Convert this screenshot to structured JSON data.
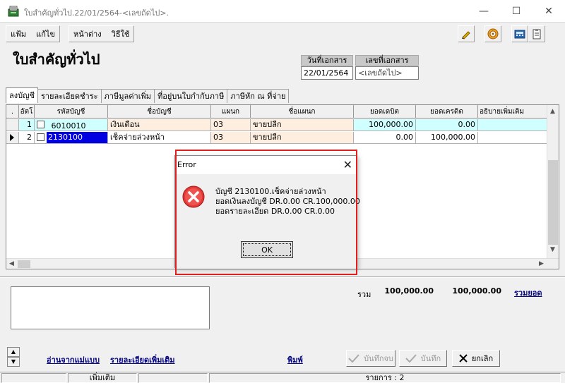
{
  "window": {
    "title": "ใบสำคัญทั่วไป.22/01/2564-<เลขถัดไป>.",
    "minimize": "—",
    "maximize": "☐",
    "close": "✕"
  },
  "menu": {
    "file": "แฟ้ม",
    "edit": "แก้ไข",
    "window": "หน้าต่าง",
    "help": "วิธีใช้"
  },
  "page_title": "ใบสำคัญทั่วไป",
  "header": {
    "doc_date_label": "วันที่เอกสาร",
    "doc_date_value": "22/01/2564",
    "doc_no_label": "เลขที่เอกสาร",
    "doc_no_value": "<เลขถัดไป>"
  },
  "tabs": [
    {
      "label": "ลงบัญชี"
    },
    {
      "label": "รายละเอียดชำระ"
    },
    {
      "label": "ภาษีมูลค่าเพิ่ม"
    },
    {
      "label": "ที่อยู่บนใบกำกับภาษี"
    },
    {
      "label": "ภาษีหัก ณ ที่จ่าย"
    }
  ],
  "grid": {
    "columns": [
      ".",
      "อัตโ",
      "รหัสบัญชี",
      "ชื่อบัญชี",
      "แผนก",
      "ชื่อแผนก",
      "ยอดเดบิต",
      "ยอดเครดิต",
      "อธิบายเพิ่มเติม"
    ],
    "rows": [
      {
        "no": "1",
        "code": "6010010",
        "name": "เงินเดือน",
        "dept": "03",
        "dept_name": "ขายปลีก",
        "debit": "100,000.00",
        "credit": "0.00",
        "note": ""
      },
      {
        "no": "2",
        "code": "2130100",
        "name": "เช็คจ่ายล่วงหน้า",
        "dept": "03",
        "dept_name": "ขายปลีก",
        "debit": "0.00",
        "credit": "100,000.00",
        "note": ""
      }
    ]
  },
  "totals": {
    "label": "รวม",
    "debit": "100,000.00",
    "credit": "100,000.00",
    "sum_link": "รวมยอด"
  },
  "links": {
    "read_template": "อ่านจากแม่แบบ",
    "more_detail": "รายละเอียดเพิ่มเติม",
    "print": "พิมพ์"
  },
  "buttons": {
    "save_close": "บันทึกจบ",
    "save": "บันทึก",
    "cancel": "ยกเลิก"
  },
  "statusbar": {
    "mode": "เพิ่มเติม",
    "items": "รายการ : 2"
  },
  "dialog": {
    "title": "Error",
    "line1": "บัญชี 2130100.เช็คจ่ายล่วงหน้า",
    "line2": "ยอดเงินลงบัญชี DR.0.00   CR.100,000.00",
    "line3": "ยอดรายละเอียด  DR.0.00   CR.0.00",
    "ok": "OK"
  },
  "colors": {
    "row1_bg": "#cfffff",
    "row_peach": "#fdeee0",
    "selected_cell": "#0000e0",
    "highlight": "#e0201c"
  }
}
